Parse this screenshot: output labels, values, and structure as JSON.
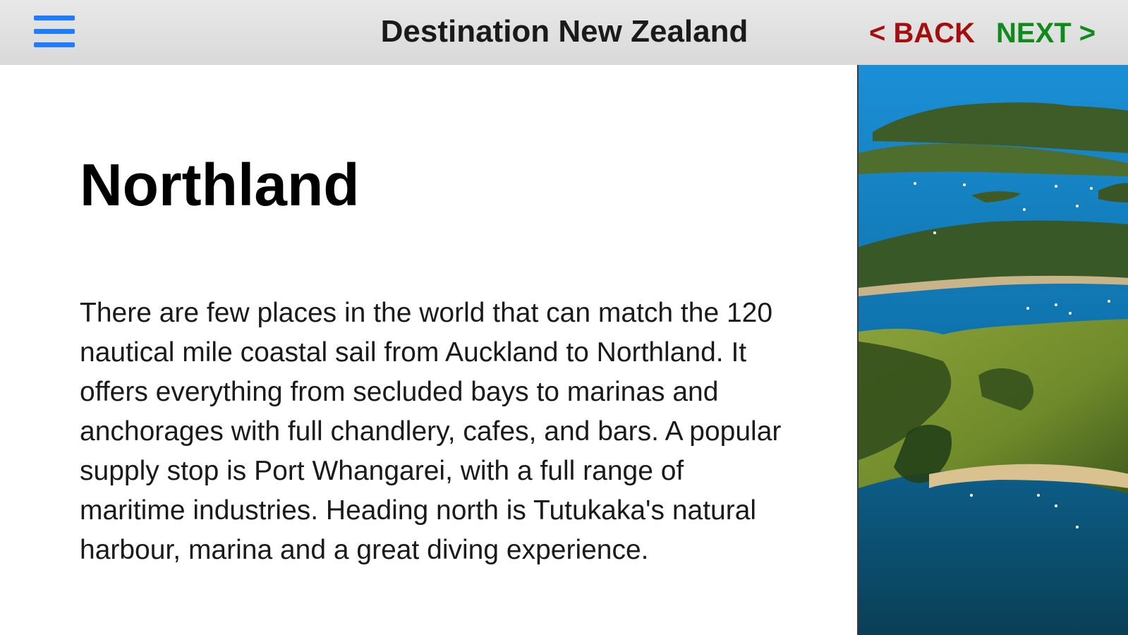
{
  "header": {
    "menu_icon": "hamburger-menu-icon",
    "title": "Destination New Zealand",
    "back_label": "< BACK",
    "next_label": "NEXT >",
    "colors": {
      "menu": "#1e7cff",
      "back": "#a30f0f",
      "next": "#0f8b1c"
    }
  },
  "main": {
    "title": "Northland",
    "body": "There are few places in the world that can match the 120 nautical mile coastal sail from Auckland to Northland. It offers everything from secluded bays to marinas and anchorages with full chandlery, cafes, and bars. A popular supply stop is Port Whangarei, with a full range of maritime industries. Heading north is Tutukaka's natural harbour, marina and a great diving experience."
  }
}
